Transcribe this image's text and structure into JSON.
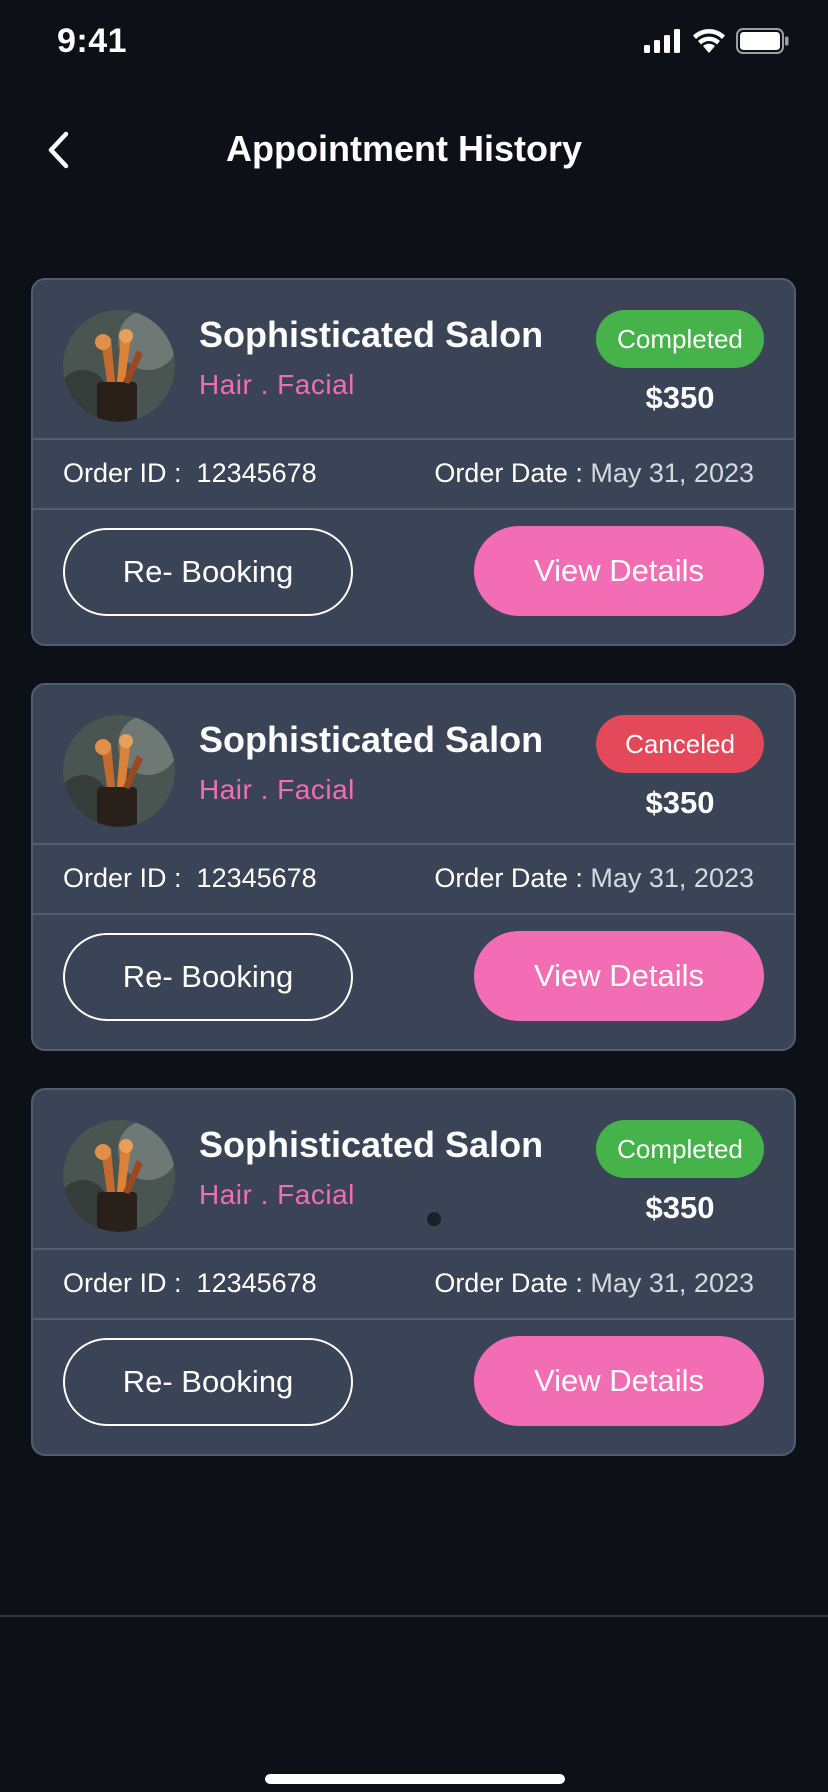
{
  "status_bar": {
    "time": "9:41"
  },
  "header": {
    "title": "Appointment History"
  },
  "colors": {
    "accent": "#f26db4",
    "completed": "#45b24a",
    "canceled": "#e4495a",
    "card_bg": "#3a4456",
    "page_bg": "#0d1016"
  },
  "cards": [
    {
      "name": "Sophisticated Salon",
      "services": "Hair . Facial",
      "status": "Completed",
      "price": "$350",
      "order_id_label": "Order ID :",
      "order_id": "12345678",
      "order_date_label": "Order Date :",
      "order_date": "May 31, 2023",
      "rebook_label": "Re- Booking",
      "details_label": "View Details"
    },
    {
      "name": "Sophisticated Salon",
      "services": "Hair . Facial",
      "status": "Canceled",
      "price": "$350",
      "order_id_label": "Order ID :",
      "order_id": "12345678",
      "order_date_label": "Order Date :",
      "order_date": "May 31, 2023",
      "rebook_label": "Re- Booking",
      "details_label": "View Details"
    },
    {
      "name": "Sophisticated Salon",
      "services": "Hair . Facial",
      "status": "Completed",
      "price": "$350",
      "order_id_label": "Order ID :",
      "order_id": "12345678",
      "order_date_label": "Order Date :",
      "order_date": "May 31, 2023",
      "rebook_label": "Re- Booking",
      "details_label": "View Details"
    }
  ]
}
